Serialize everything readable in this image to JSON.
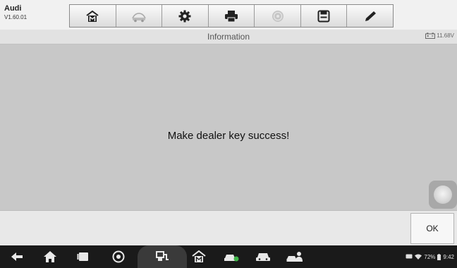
{
  "header": {
    "app_name": "Audi",
    "version": "V1.60.01",
    "toolbar": [
      {
        "icon": "home-icon"
      },
      {
        "icon": "vehicle-swap-icon"
      },
      {
        "icon": "gear-icon"
      },
      {
        "icon": "printer-icon"
      },
      {
        "icon": "help-icon"
      },
      {
        "icon": "save-icon"
      },
      {
        "icon": "pen-icon"
      }
    ]
  },
  "info_bar": {
    "title": "Information",
    "battery_voltage": "11.68V"
  },
  "main": {
    "message": "Make dealer key success!"
  },
  "actions": {
    "ok_label": "OK"
  },
  "system_bar": {
    "battery_percent": "72%",
    "time": "9:42"
  }
}
